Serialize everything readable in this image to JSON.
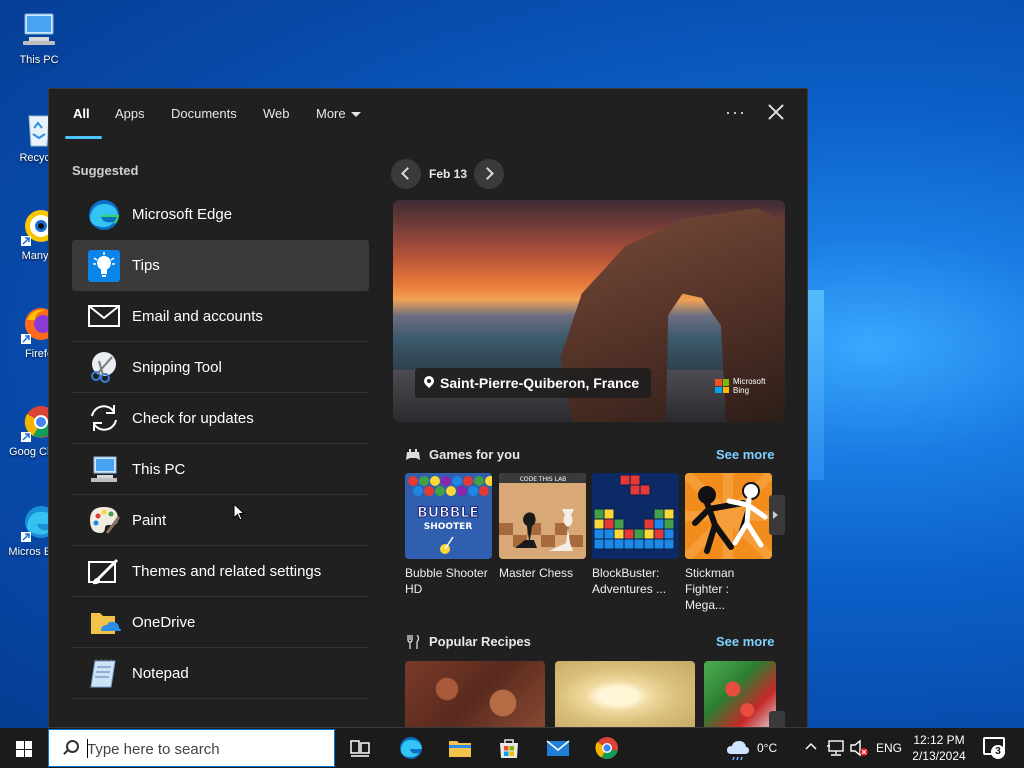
{
  "desktop": {
    "icons": [
      {
        "label": "This PC"
      },
      {
        "label": "Recycle"
      },
      {
        "label": "ManyC"
      },
      {
        "label": "Firefo"
      },
      {
        "label": "Goog Chron"
      },
      {
        "label": "Micros Edge"
      }
    ]
  },
  "search_panel": {
    "tabs": [
      {
        "label": "All",
        "active": true
      },
      {
        "label": "Apps"
      },
      {
        "label": "Documents"
      },
      {
        "label": "Web"
      },
      {
        "label": "More"
      }
    ],
    "options_icon": "more-options-icon",
    "suggested_title": "Suggested",
    "suggested": [
      {
        "label": "Microsoft Edge",
        "icon": "edge-icon"
      },
      {
        "label": "Tips",
        "icon": "lightbulb-icon",
        "selected": true
      },
      {
        "label": "Email and accounts",
        "icon": "mail-icon"
      },
      {
        "label": "Snipping Tool",
        "icon": "scissors-icon"
      },
      {
        "label": "Check for updates",
        "icon": "sync-icon"
      },
      {
        "label": "This PC",
        "icon": "computer-icon"
      },
      {
        "label": "Paint",
        "icon": "palette-icon"
      },
      {
        "label": "Themes and related settings",
        "icon": "brush-icon"
      },
      {
        "label": "OneDrive",
        "icon": "folder-cloud-icon"
      },
      {
        "label": "Notepad",
        "icon": "notepad-icon"
      }
    ],
    "date_nav": {
      "label": "Feb 13"
    },
    "hero": {
      "location": "Saint-Pierre-Quiberon, France",
      "brand_line1": "Microsoft",
      "brand_line2": "Bing"
    },
    "games": {
      "title": "Games for you",
      "see_more": "See more",
      "items": [
        {
          "name": "Bubble Shooter HD",
          "thumb_text": "BUBBLE SHOOTER"
        },
        {
          "name": "Master Chess",
          "thumb_text": "CODE THIS LAB"
        },
        {
          "name": "BlockBuster: Adventures ..."
        },
        {
          "name": "Stickman Fighter : Mega..."
        }
      ]
    },
    "recipes": {
      "title": "Popular Recipes",
      "see_more": "See more"
    }
  },
  "taskbar": {
    "search_placeholder": "Type here to search",
    "weather": "0°C",
    "language": "ENG",
    "time": "12:12 PM",
    "date": "2/13/2024",
    "notification_count": "3"
  },
  "colors": {
    "accent": "#4cc2ff",
    "panel_bg": "#202020",
    "selected_bg": "#3a3a3a",
    "link": "#7fd1ff"
  }
}
